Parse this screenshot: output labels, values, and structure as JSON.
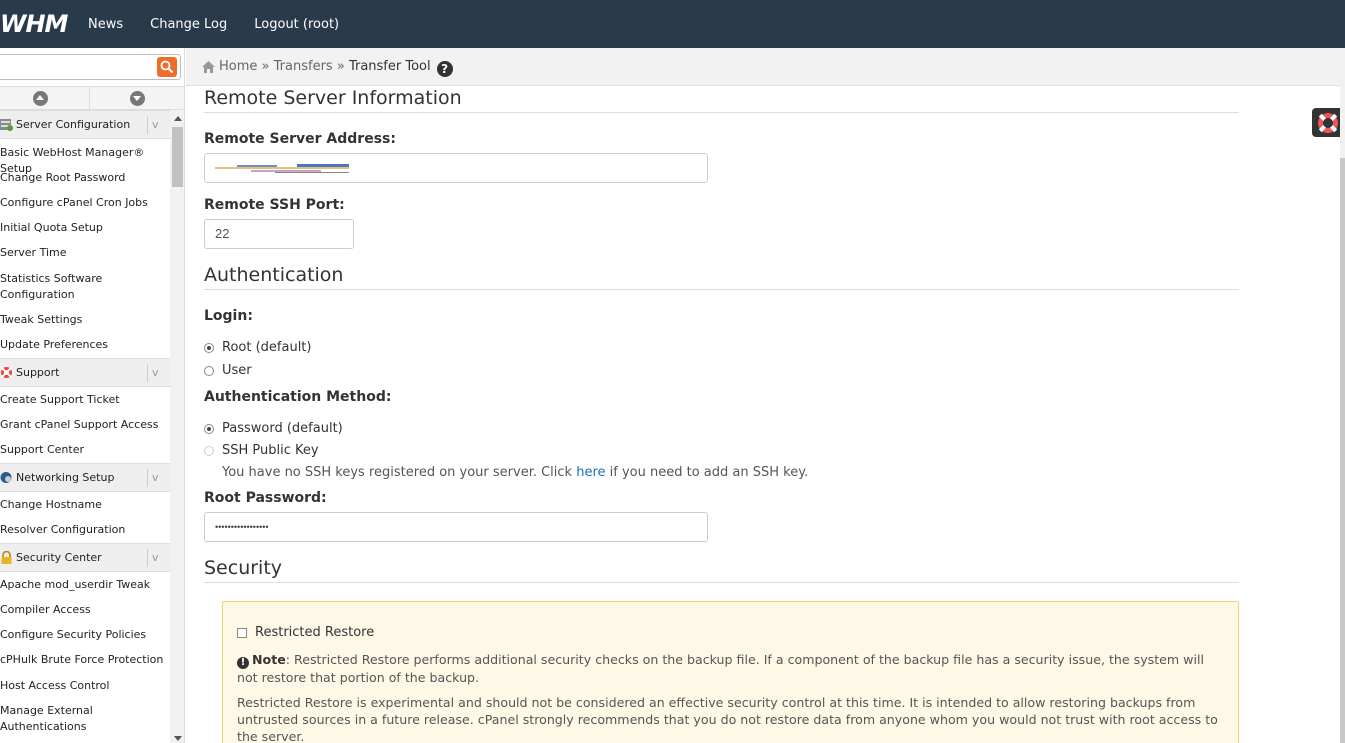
{
  "topbar": {
    "logo": "WHM",
    "nav": [
      "News",
      "Change Log",
      "Logout (root)"
    ]
  },
  "sidebar": {
    "search_placeholder": "",
    "sections": [
      {
        "title": "Server Configuration",
        "icon": "server-config-icon",
        "items": [
          "Basic WebHost Manager® Setup",
          "Change Root Password",
          "Configure cPanel Cron Jobs",
          "Initial Quota Setup",
          "Server Time",
          "Statistics Software Configuration",
          "Tweak Settings",
          "Update Preferences"
        ]
      },
      {
        "title": "Support",
        "icon": "lifebuoy-icon",
        "items": [
          "Create Support Ticket",
          "Grant cPanel Support Access",
          "Support Center"
        ]
      },
      {
        "title": "Networking Setup",
        "icon": "network-icon",
        "items": [
          "Change Hostname",
          "Resolver Configuration"
        ]
      },
      {
        "title": "Security Center",
        "icon": "lock-icon",
        "items": [
          "Apache mod_userdir Tweak",
          "Compiler Access",
          "Configure Security Policies",
          "cPHulk Brute Force Protection",
          "Host Access Control",
          "Manage External Authentications"
        ]
      }
    ]
  },
  "breadcrumb": {
    "home": "Home",
    "sep": "»",
    "transfers": "Transfers",
    "current": "Transfer Tool"
  },
  "remote": {
    "heading": "Remote Server Information",
    "address_label": "Remote Server Address:",
    "ssh_port_label": "Remote SSH Port:",
    "ssh_port_value": "22"
  },
  "auth": {
    "heading": "Authentication",
    "login_label": "Login:",
    "login_root": "Root (default)",
    "login_user": "User",
    "method_label": "Authentication Method:",
    "method_password": "Password (default)",
    "method_ssh": "SSH Public Key",
    "ssh_hint_pre": "You have no SSH keys registered on your server. Click ",
    "ssh_hint_link": "here",
    "ssh_hint_post": " if you need to add an SSH key.",
    "root_password_label": "Root Password:",
    "root_password_value": "•••••••••••••••••"
  },
  "security": {
    "heading": "Security",
    "restricted_label": "Restricted Restore",
    "note_label": "Note",
    "note_text": ": Restricted Restore performs additional security checks on the backup file. If a component of the backup file has a security issue, the system will not restore that portion of the backup.",
    "experimental_text": "Restricted Restore is experimental and should not be considered an effective security control at this time. It is intended to allow restoring backups from untrusted sources in a future release. cPanel strongly recommends that you do not restore data from anyone whom you would not trust with root access to the server."
  },
  "colors": {
    "topbar": "#293a4a",
    "accent": "#ef6c2b",
    "link": "#1a6fb3",
    "warn_bg": "#fef9e7",
    "warn_border": "#f3d46b"
  }
}
